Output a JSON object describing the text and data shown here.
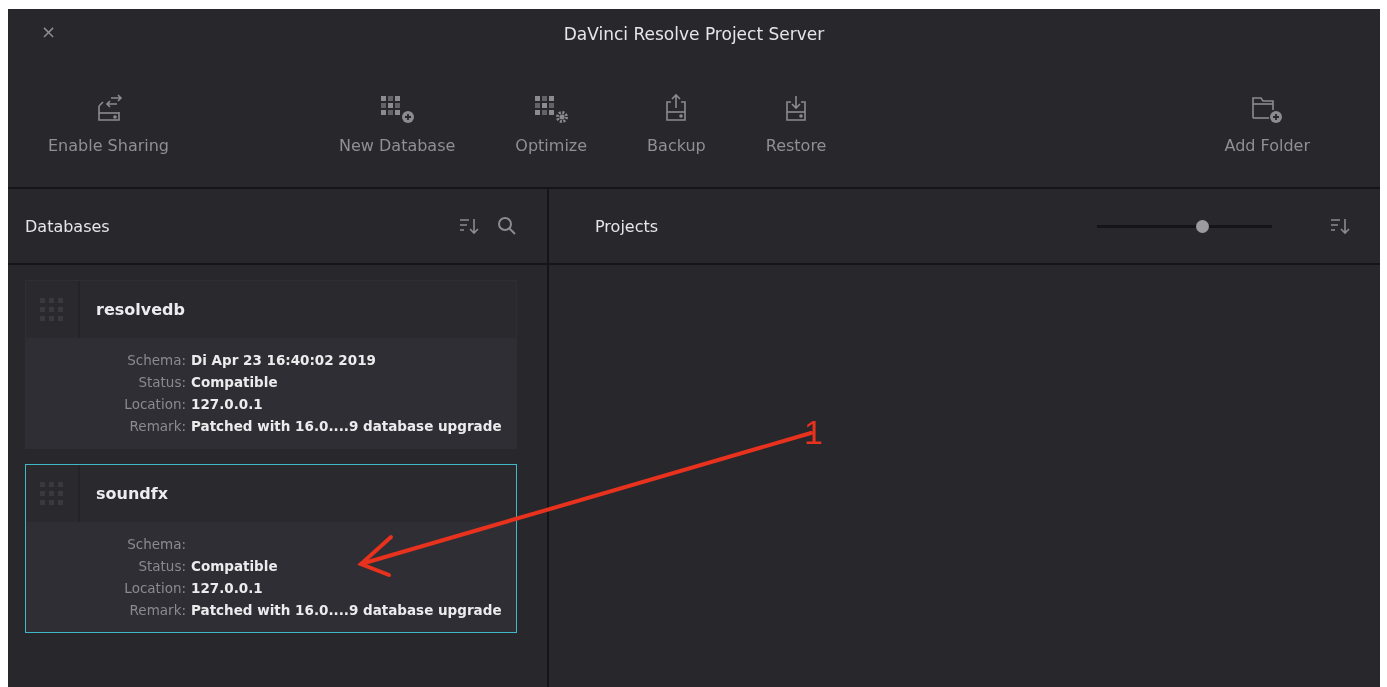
{
  "window": {
    "title": "DaVinci Resolve Project Server",
    "close": "×"
  },
  "toolbar": [
    {
      "kind": "sharing",
      "label": "Enable Sharing"
    },
    {
      "kind": "newdb",
      "label": "New Database"
    },
    {
      "kind": "optimize",
      "label": "Optimize"
    },
    {
      "kind": "backup",
      "label": "Backup"
    },
    {
      "kind": "restore",
      "label": "Restore"
    },
    {
      "kind": "spacer"
    },
    {
      "kind": "folder",
      "label": "Add Folder"
    }
  ],
  "databases": {
    "title": "Databases",
    "items": [
      {
        "name": "resolvedb",
        "selected": false,
        "fields": [
          {
            "label": "Schema:",
            "value": "Di Apr 23 16:40:02 2019"
          },
          {
            "label": "Status:",
            "value": "Compatible"
          },
          {
            "label": "Location:",
            "value": "127.0.0.1"
          },
          {
            "label": "Remark:",
            "value": "Patched with 16.0....9 database upgrade"
          }
        ]
      },
      {
        "name": "soundfx",
        "selected": true,
        "fields": [
          {
            "label": "Schema:"
          },
          {
            "label": "Status:",
            "value": "Compatible"
          },
          {
            "label": "Location:",
            "value": "127.0.0.1"
          },
          {
            "label": "Remark:",
            "value": "Patched with 16.0....9 database upgrade"
          }
        ]
      }
    ]
  },
  "projects": {
    "title": "Projects",
    "zoom": {
      "level": 0.6
    }
  },
  "annotation": {
    "label": "1"
  }
}
